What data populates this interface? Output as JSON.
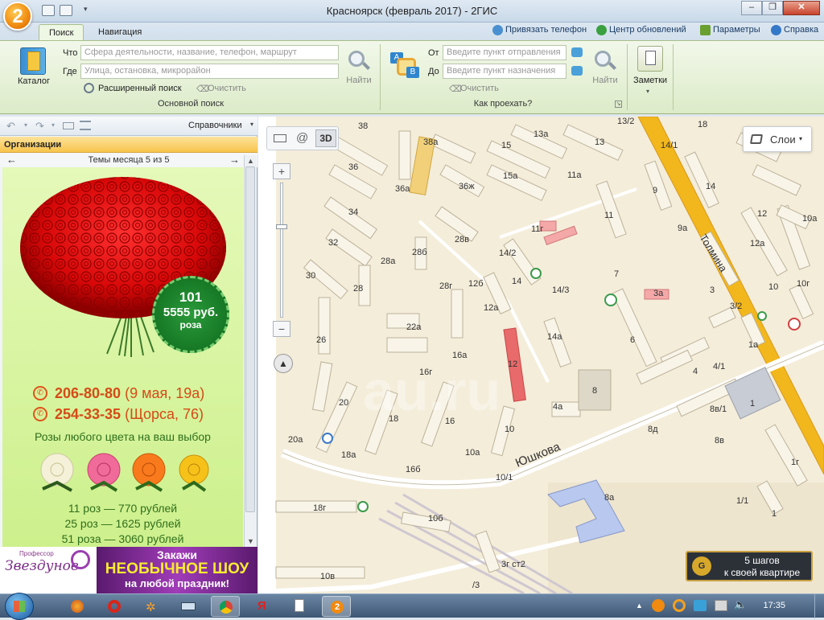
{
  "window": {
    "title": "Красноярск (февраль 2017) - 2ГИС",
    "logo": "2",
    "min": "–",
    "max": "❐",
    "close": "✕"
  },
  "tabs": [
    {
      "label": "Поиск"
    },
    {
      "label": "Навигация"
    }
  ],
  "toplinks": [
    {
      "label": "Привязать телефон",
      "icon": "phone-link-icon"
    },
    {
      "label": "Центр обновлений",
      "icon": "update-icon"
    },
    {
      "label": "Параметры",
      "icon": "gear-icon"
    },
    {
      "label": "Справка",
      "icon": "help-icon"
    }
  ],
  "ribbon": {
    "catalog_label": "Каталог",
    "what_label": "Что",
    "what_placeholder": "Сфера деятельности, название, телефон, маршрут",
    "where_label": "Где",
    "where_placeholder": "Улица, остановка, микрорайон",
    "find_label": "Найти",
    "advanced_label": "Расширенный поиск",
    "clear_label": "Очистить",
    "group_search": "Основной поиск",
    "from_label": "От",
    "from_placeholder": "Введите пункт отправления",
    "to_label": "До",
    "to_placeholder": "Введите пункт назначения",
    "route_find_label": "Найти",
    "route_clear_label": "Очистить",
    "group_route": "Как проехать?",
    "notes_label": "Заметки",
    "route_a": "A",
    "route_b": "B"
  },
  "left_panel": {
    "dropdown": "Справочники",
    "header": "Организации",
    "themes": "Темы месяца 5 из 5",
    "ad": {
      "badge_count": "101",
      "badge_price": "5555 руб.",
      "badge_item": "роза",
      "phone1": "206-80-80",
      "addr1": "(9 мая, 19а)",
      "phone2": "254-33-35",
      "addr2": "(Щорса, 76)",
      "tagline": "Розы любого цвета на ваш выбор",
      "prices": [
        "11 роз — 770 рублей",
        "25 роз — 1625 рублей",
        "51 роза — 3060 рублей"
      ]
    },
    "banner": {
      "brand_small": "Профессор",
      "brand": "Звездунов",
      "line1": "Закажи",
      "line2": "НЕОБЫЧНОЕ ШОУ",
      "line3": "на любой праздник!"
    }
  },
  "map": {
    "layers_label": "Слои",
    "view_3d": "3D",
    "promo_line1": "5 шагов",
    "promo_line2": "к своей квартире",
    "zoom_in": "+",
    "zoom_out": "−",
    "streets": [
      "Юшкова",
      "Толмина"
    ],
    "labels": [
      "38",
      "38а",
      "15",
      "13а",
      "13",
      "13/2",
      "14/1",
      "18",
      "36",
      "36а",
      "36ж",
      "15а",
      "11а",
      "9",
      "14",
      "34",
      "11г",
      "11",
      "9а",
      "12",
      "12а",
      "10а",
      "32",
      "28в",
      "28б",
      "28а",
      "14/2",
      "7",
      "3а",
      "3",
      "3/2",
      "10",
      "10г",
      "30",
      "28",
      "28г",
      "12б",
      "12а",
      "14",
      "14/3",
      "22а",
      "16а",
      "14а",
      "6",
      "4",
      "4/1",
      "1а",
      "26",
      "12",
      "16г",
      "8",
      "4а",
      "20",
      "18",
      "16",
      "10",
      "8д",
      "8в/1",
      "8в",
      "1",
      "20а",
      "18а",
      "16б",
      "10а",
      "10/1",
      "8а",
      "1г",
      "18г",
      "10б",
      "1/1",
      "1",
      "10в",
      "3г ст2",
      "/3"
    ]
  },
  "taskbar": {
    "time": "17:35"
  }
}
